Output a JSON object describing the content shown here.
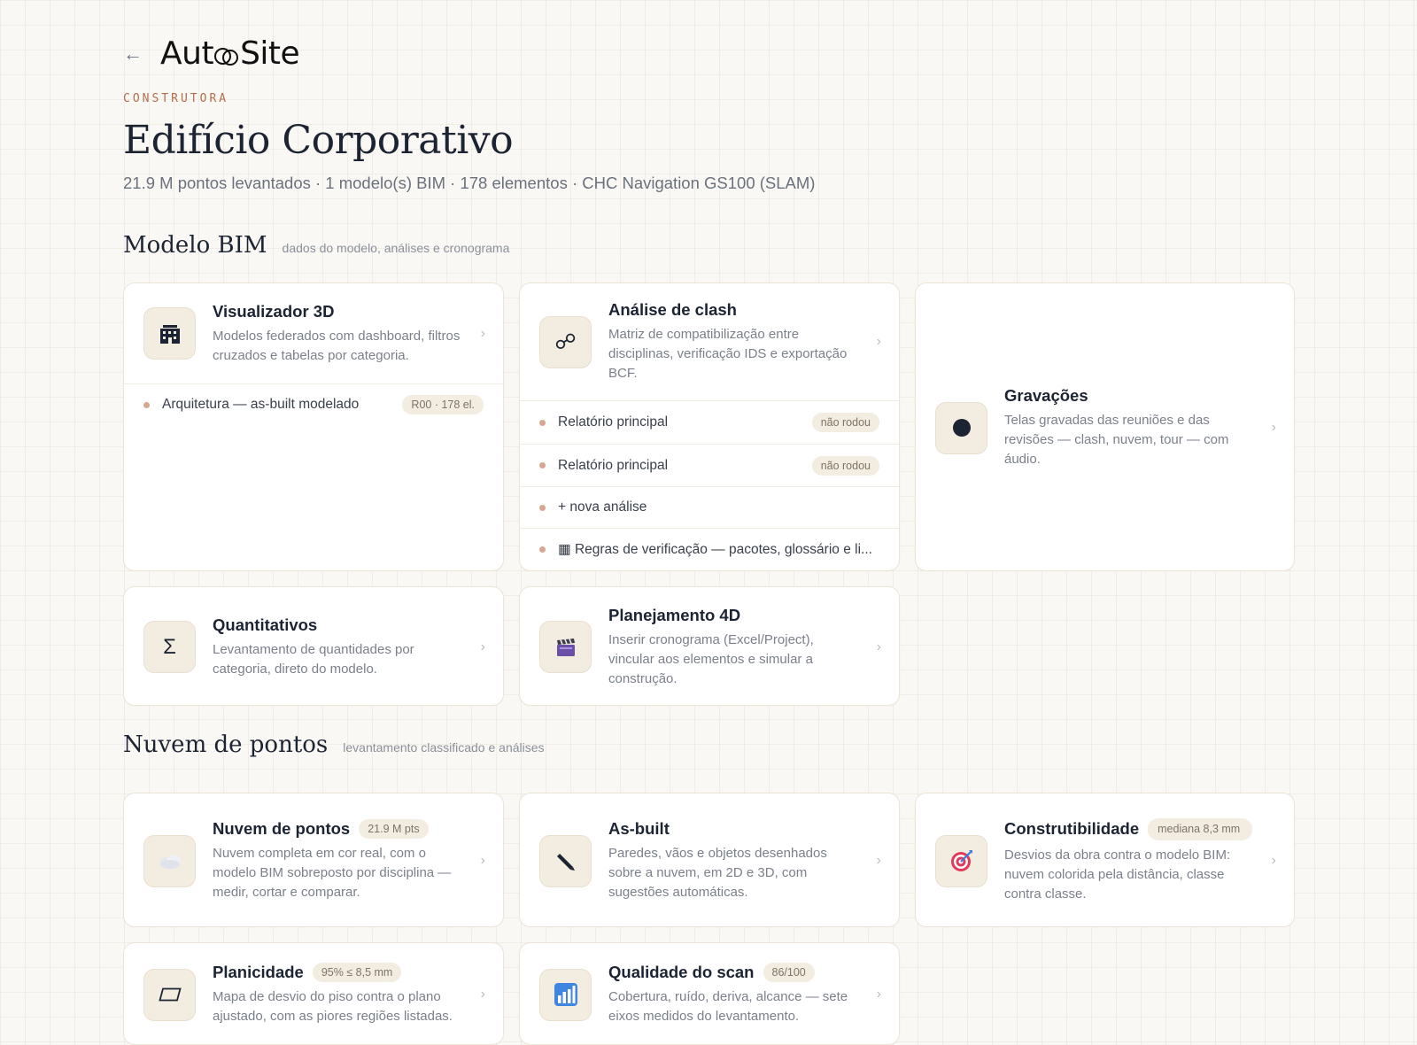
{
  "header": {
    "back_icon": "←",
    "logo": "AutoSite",
    "eyebrow": "CONSTRUTORA",
    "title": "Edifício Corporativo",
    "subtitle": "21.9 M pontos levantados · 1 modelo(s) BIM · 178 elementos · CHC Navigation GS100 (SLAM)"
  },
  "sections": {
    "bim": {
      "title": "Modelo BIM",
      "hint": "dados do modelo, análises e cronograma"
    },
    "cloud": {
      "title": "Nuvem de pontos",
      "hint": "levantamento classificado e análises"
    }
  },
  "cards": {
    "viewer": {
      "title": "Visualizador 3D",
      "desc": "Modelos federados com dashboard, filtros cruzados e tabelas por categoria.",
      "icon": "building-crane-icon",
      "rows": [
        {
          "label": "Arquitetura — as-built modelado",
          "badge": "R00 · 178 el."
        }
      ]
    },
    "clash": {
      "title": "Análise de clash",
      "desc": "Matriz de compatibilização entre disciplinas, verificação IDS e exportação BCF.",
      "icon": "link-icon",
      "icon_glyph": "☍",
      "rows": [
        {
          "label": "Relatório principal",
          "badge": "não rodou"
        },
        {
          "label": "Relatório principal",
          "badge": "não rodou"
        },
        {
          "label": "+ nova análise"
        },
        {
          "label": "▦ Regras de verificação — pacotes, glossário e li..."
        }
      ]
    },
    "recordings": {
      "title": "Gravações",
      "desc": "Telas gravadas das reuniões e das revisões — clash, nuvem, tour — com áudio.",
      "icon": "record-dot-icon"
    },
    "quantities": {
      "title": "Quantitativos",
      "desc": "Levantamento de quantidades por categoria, direto do modelo.",
      "icon": "sigma-icon",
      "icon_glyph": "Σ"
    },
    "planning": {
      "title": "Planejamento 4D",
      "desc": "Inserir cronograma (Excel/Project), vincular aos elementos e simular a construção.",
      "icon": "clapperboard-icon"
    },
    "pointcloud": {
      "title": "Nuvem de pontos",
      "badge": "21.9 M pts",
      "desc": "Nuvem completa em cor real, com o modelo BIM sobreposto por disciplina — medir, cortar e comparar.",
      "icon": "cloud-icon"
    },
    "asbuilt": {
      "title": "As-built",
      "desc": "Paredes, vãos e objetos desenhados sobre a nuvem, em 2D e 3D, com sugestões automáticas.",
      "icon": "pen-icon"
    },
    "constructability": {
      "title": "Construtibilidade",
      "badge": "mediana 8,3 mm",
      "desc": "Desvios da obra contra o modelo BIM: nuvem colorida pela distância, classe contra classe.",
      "icon": "target-icon"
    },
    "flatness": {
      "title": "Planicidade",
      "badge": "95% ≤ 8,5 mm",
      "desc": "Mapa de desvio do piso contra o plano ajustado, com as piores regiões listadas.",
      "icon": "parallelogram-icon"
    },
    "scanquality": {
      "title": "Qualidade do scan",
      "badge": "86/100",
      "desc": "Cobertura, ruído, deriva, alcance — sete eixos medidos do levantamento.",
      "icon": "bar-chart-icon"
    }
  },
  "chevron": "›",
  "colors": {
    "accent": "#b36d4c",
    "card_border": "#ece4d6",
    "icon_bg": "#f3ece0",
    "dot": "#d8a690"
  }
}
